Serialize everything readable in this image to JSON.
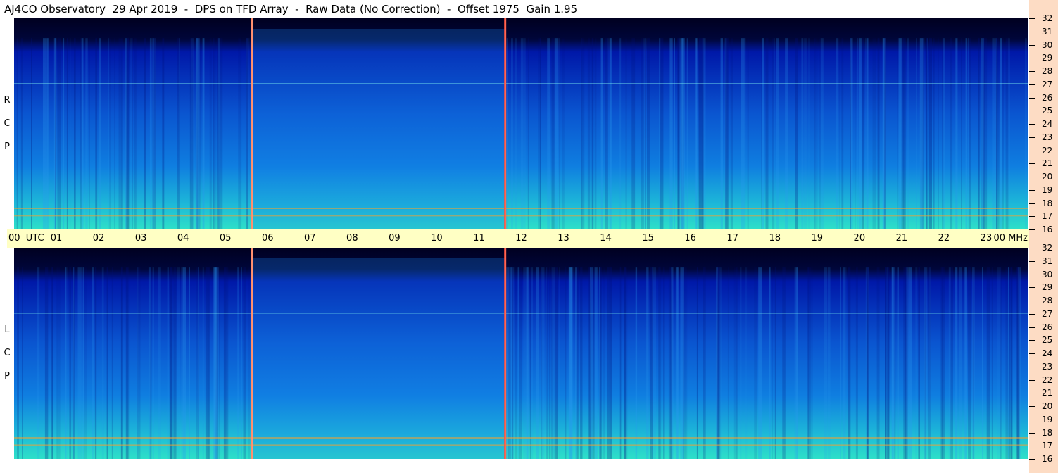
{
  "title": "AJ4CO Observatory  29 Apr 2019  -  DPS on TFD Array  -  Raw Data (No Correction)  -  Offset 1975  Gain 1.95",
  "panels": {
    "top": {
      "polarization": [
        "R",
        "C",
        "P"
      ]
    },
    "bottom": {
      "polarization": [
        "L",
        "C",
        "P"
      ]
    }
  },
  "time_axis": {
    "ticks": [
      "00  UTC",
      "01",
      "02",
      "03",
      "04",
      "05",
      "06",
      "07",
      "08",
      "09",
      "10",
      "11",
      "12",
      "13",
      "14",
      "15",
      "16",
      "17",
      "18",
      "19",
      "20",
      "21",
      "22",
      "23",
      "00 MHz"
    ]
  },
  "colors": {
    "background_top": "#000020",
    "low_signal": "#0018a8",
    "mid_signal": "#0f7ee0",
    "high_signal": "#2ee0c8",
    "hot_signal": "#f4a030",
    "marker_line": "#ff5040",
    "time_axis_bg": "#ffffc4",
    "freq_axis_bg": "#fddcc4"
  },
  "chart_data": {
    "type": "heatmap",
    "title": "AJ4CO Observatory  29 Apr 2019  -  DPS on TFD Array  -  Raw Data (No Correction)  -  Offset 1975  Gain 1.95",
    "x": {
      "unit": "UTC hour",
      "range": [
        0,
        24
      ],
      "tick_labels": [
        "00  UTC",
        "01",
        "02",
        "03",
        "04",
        "05",
        "06",
        "07",
        "08",
        "09",
        "10",
        "11",
        "12",
        "13",
        "14",
        "15",
        "16",
        "17",
        "18",
        "19",
        "20",
        "21",
        "22",
        "23",
        "00 MHz"
      ]
    },
    "y": {
      "unit": "MHz",
      "range": [
        16,
        32
      ],
      "tick_labels": [
        "16",
        "17",
        "18",
        "19",
        "20",
        "21",
        "22",
        "23",
        "24",
        "25",
        "26",
        "27",
        "28",
        "29",
        "30",
        "31",
        "32"
      ]
    },
    "panels": [
      {
        "label": "R C P"
      },
      {
        "label": "L C P"
      }
    ],
    "vertical_markers_utc": [
      5.63,
      11.62
    ],
    "interference_lines_mhz": [
      17.05,
      17.6,
      27.05
    ],
    "grid": false,
    "legend": "none"
  }
}
